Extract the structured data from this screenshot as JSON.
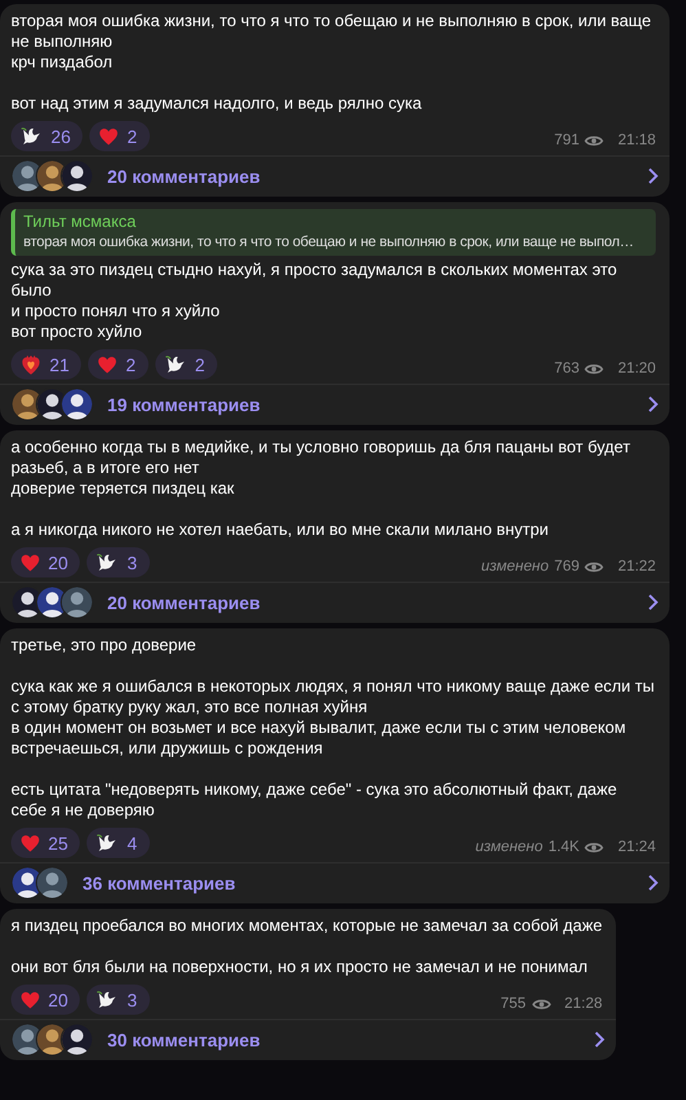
{
  "posts": [
    {
      "paragraphs": [
        "вторая моя ошибка жизни, то что я что то обещаю и не выполняю в срок, или ваще не выполняю\nкрч пиздабол",
        "вот над этим я задумался надолго, и ведь рялно сука"
      ],
      "reactions": [
        {
          "kind": "dove",
          "count": "26"
        },
        {
          "kind": "heart",
          "count": "2"
        }
      ],
      "views": "791",
      "time": "21:18",
      "comments": "20 комментариев",
      "avatars": [
        {
          "kind": "picture"
        },
        {
          "kind": "picture"
        },
        {
          "kind": "picture"
        }
      ]
    },
    {
      "quote": {
        "author": "Тильт мсмакса",
        "text": "вторая моя ошибка жизни, то что я что то обещаю и не выполняю в срок, или ваще не выпол…"
      },
      "paragraphs": [
        "сука за это пиздец стыдно нахуй, я просто задумался в скольких моментах это было\nи просто понял что я хуйло\nвот просто хуйло"
      ],
      "reactions": [
        {
          "kind": "fire_heart",
          "count": "21"
        },
        {
          "kind": "heart",
          "count": "2"
        },
        {
          "kind": "dove",
          "count": "2"
        }
      ],
      "views": "763",
      "time": "21:20",
      "comments": "19 комментариев",
      "avatars": [
        {
          "kind": "picture"
        },
        {
          "kind": "picture"
        },
        {
          "kind": "picture"
        }
      ]
    },
    {
      "paragraphs": [
        "а особенно когда ты в медийке, и ты условно говоришь да бля пацаны вот будет разьеб, а в итоге его нет\nдоверие теряется пиздец как",
        "а я никогда никого не хотел наебать, или во мне скали милано внутри"
      ],
      "reactions": [
        {
          "kind": "heart",
          "count": "20"
        },
        {
          "kind": "dove",
          "count": "3"
        }
      ],
      "edited": "изменено",
      "views": "769",
      "time": "21:22",
      "comments": "20 комментариев",
      "avatars": [
        {
          "kind": "picture"
        },
        {
          "kind": "picture"
        },
        {
          "kind": "picture"
        }
      ]
    },
    {
      "paragraphs": [
        "третье, это про доверие",
        "сука как же я ошибался в некоторых людях, я понял что никому ваще даже если ты с этому братку руку жал, это все полная хуйня\nв один момент он возьмет и все нахуй вывалит, даже если ты с этим человеком встречаешься, или дружишь с рождения",
        "есть цитата \"недоверять никому, даже себе\" - сука это абсолютный факт, даже себе я не доверяю"
      ],
      "reactions": [
        {
          "kind": "heart",
          "count": "25"
        },
        {
          "kind": "dove",
          "count": "4"
        }
      ],
      "edited": "изменено",
      "views": "1.4K",
      "time": "21:24",
      "comments": "36 комментариев",
      "avatars": [
        {
          "kind": "picture"
        },
        {
          "kind": "picture"
        }
      ]
    },
    {
      "paragraphs": [
        "я пиздец проебался во многих моментах, которые не замечал за собой даже",
        "они вот бля были на поверхности, но я их просто не замечал и не понимал"
      ],
      "reactions": [
        {
          "kind": "heart",
          "count": "20"
        },
        {
          "kind": "dove",
          "count": "3"
        }
      ],
      "views": "755",
      "time": "21:28",
      "comments": "30 комментариев",
      "avatars": [
        {
          "kind": "picture"
        },
        {
          "kind": "picture"
        },
        {
          "kind": "picture"
        }
      ]
    }
  ]
}
